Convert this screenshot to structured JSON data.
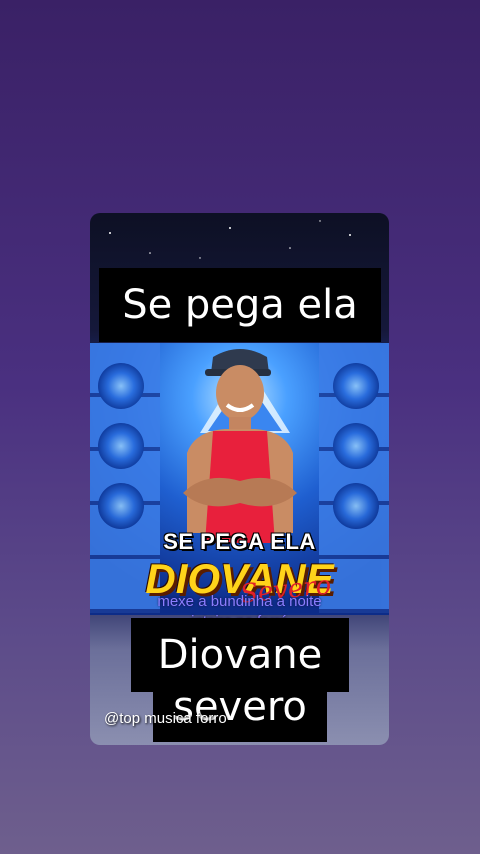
{
  "video": {
    "caption_top": "Se pega ela",
    "caption_bottom_line1": "Diovane",
    "caption_bottom_line2": "severo",
    "lyric_line1": "mexe a bundinha a noite",
    "lyric_line2": "inteira no forró",
    "watermark": "@top musica forro"
  },
  "cover_art": {
    "title": "SE PEGA ELA",
    "artist": "DIOVANE",
    "signature": "Severo",
    "colors": {
      "title": "#ffffff",
      "artist": "#ffd31a",
      "signature": "#e0202a",
      "background": "#1f5fd0"
    }
  },
  "colors": {
    "page_background_top": "#3a2166",
    "page_background_bottom": "#6e5f8d",
    "caption_background": "#000000",
    "caption_text": "#ffffff",
    "lyric_text": "#8a7dff"
  }
}
